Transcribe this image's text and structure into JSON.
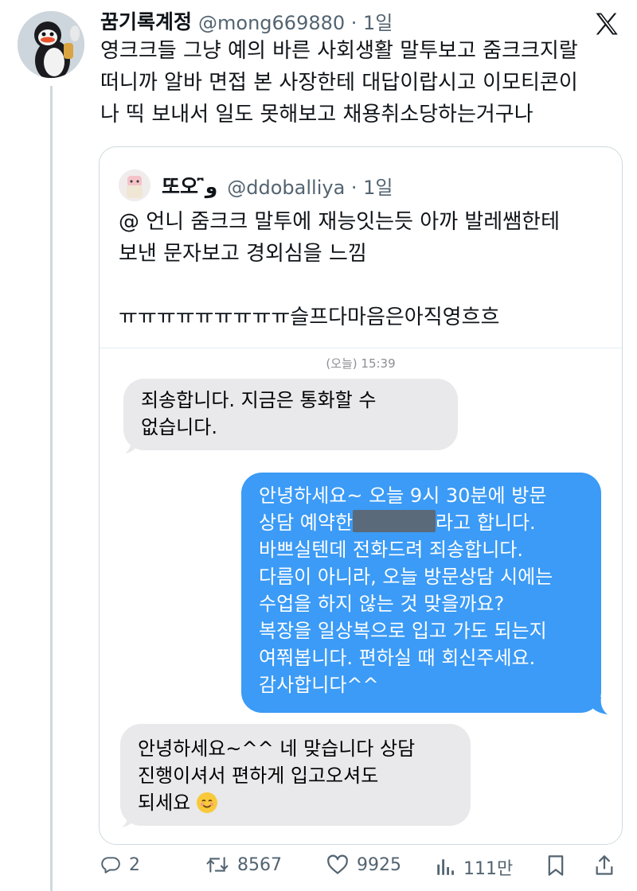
{
  "tweet": {
    "display_name": "꿈기록계정",
    "handle_time": "@mong669880 · 1일",
    "text": "영크크들 그냥 예의 바른 사회생활 말투보고 줌크크지랄\n떠니까 알바 면접 본 사장한테 대답이랍시고 이모티콘이\n나 띡 보내서 일도 못해보고 채용취소당하는거구나"
  },
  "quote": {
    "display_name": "또오 ̑̈و",
    "handle_time": "@ddoballiya · 1일",
    "text": "@ 언니 줌크크 말투에 재능잇는듯 아까 발레쌤한테\n보낸 문자보고 경외심을 느낌\n\nㅠㅠㅠㅠㅠㅠㅠㅠㅠ슬프다마음은아직영흐흐"
  },
  "messages": {
    "timestamp": "(오늘) 15:39",
    "m1": "죄송합니다. 지금은 통화할 수\n없습니다.",
    "m2_line1": "안녕하세요~ 오늘 9시 30분에 방문",
    "m2_line2_pre": "상담 예약한",
    "m2_line2_post": "라고 합니다.",
    "m2_rest": "바쁘실텐데 전화드려 죄송합니다.\n다름이 아니라, 오늘 방문상담 시에는\n수업을 하지 않는 것 맞을까요?\n복장을 일상복으로 입고 가도 되는지\n여쭤봅니다. 편하실 때 회신주세요.\n감사합니다^^",
    "m3_text": "안녕하세요~^^ 네 맞습니다 상담\n진행이셔서 편하게 입고오셔도\n되세요"
  },
  "actions": {
    "replies": "2",
    "retweets": "8567",
    "likes": "9925",
    "views": "111만"
  },
  "colors": {
    "sent_bubble": "#3b9bf6",
    "received_bubble": "#e9e9eb",
    "secondary_text": "#536471"
  },
  "icons": [
    "x-logo-icon",
    "reply-icon",
    "retweet-icon",
    "like-icon",
    "views-icon",
    "bookmark-icon",
    "share-icon",
    "smiling-face-emoji"
  ]
}
